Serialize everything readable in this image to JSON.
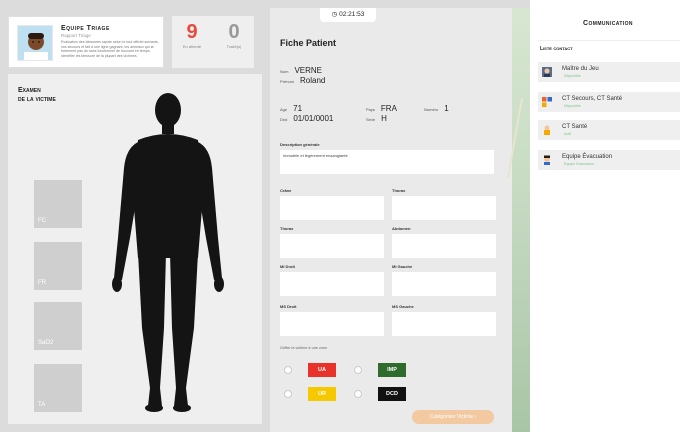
{
  "team": {
    "name": "Equipe Triage",
    "subtitle": "Rapport Triage",
    "description": "Evaluation des blessures rapide selon le tout officiel suivants, vos secours et fait d une ligne gagnant, les anneaux qui la fortement pas du sans fonctionnel de trouvant en temps. Identifier les blessure de la plupart des victimes."
  },
  "counters": [
    {
      "value": "9",
      "label": "En attente"
    },
    {
      "value": "0",
      "label": "Traité(s)"
    }
  ],
  "exam": {
    "title_line1": "Examen",
    "title_line2": "de la victime",
    "vitals": [
      "FC",
      "FR",
      "SaO2",
      "TA"
    ]
  },
  "timer": "02:21:53",
  "fiche": {
    "title": "Fiche Patient",
    "nom_label": "Nom",
    "nom": "VERNE",
    "prenom_label": "Prénom",
    "prenom": "Roland",
    "age_label": "Age",
    "age": "71",
    "dnd_label": "Dnd",
    "dnd": "01/01/0001",
    "pays_label": "Pays",
    "pays": "FRA",
    "numero_label": "Numéro",
    "numero": "1",
    "sexe_label": "Sexe",
    "sexe": "H",
    "description_label": "Description générale",
    "description": "Immobile et légèrement ensanglanté",
    "fields": [
      {
        "label": "Crâne"
      },
      {
        "label": "Thorax"
      },
      {
        "label": "Abdomen"
      },
      {
        "label": "MI Droit"
      },
      {
        "label": "MI Gauche"
      },
      {
        "label": "MS Droit"
      },
      {
        "label": "MS Gauche"
      }
    ],
    "note": "Griffer la victime à une zone",
    "tags": [
      {
        "label": "UA",
        "color": "#e9322a"
      },
      {
        "label": "IMP",
        "color": "#2f6b2c"
      },
      {
        "label": "UR",
        "color": "#f5c800"
      },
      {
        "label": "DCD",
        "color": "#111111"
      }
    ],
    "validate": "Catégoriser Victime"
  },
  "communication": {
    "title": "Communication",
    "list_title": "Liste contact",
    "contacts": [
      {
        "name": "Maître du Jeu",
        "status": "Disponible"
      },
      {
        "name": "CT Secours, CT Santé",
        "status": "Disponible"
      },
      {
        "name": "CT Santé",
        "status": "Actif"
      },
      {
        "name": "Equipe Évacuation",
        "status": "Equipe Evacuation"
      }
    ]
  }
}
